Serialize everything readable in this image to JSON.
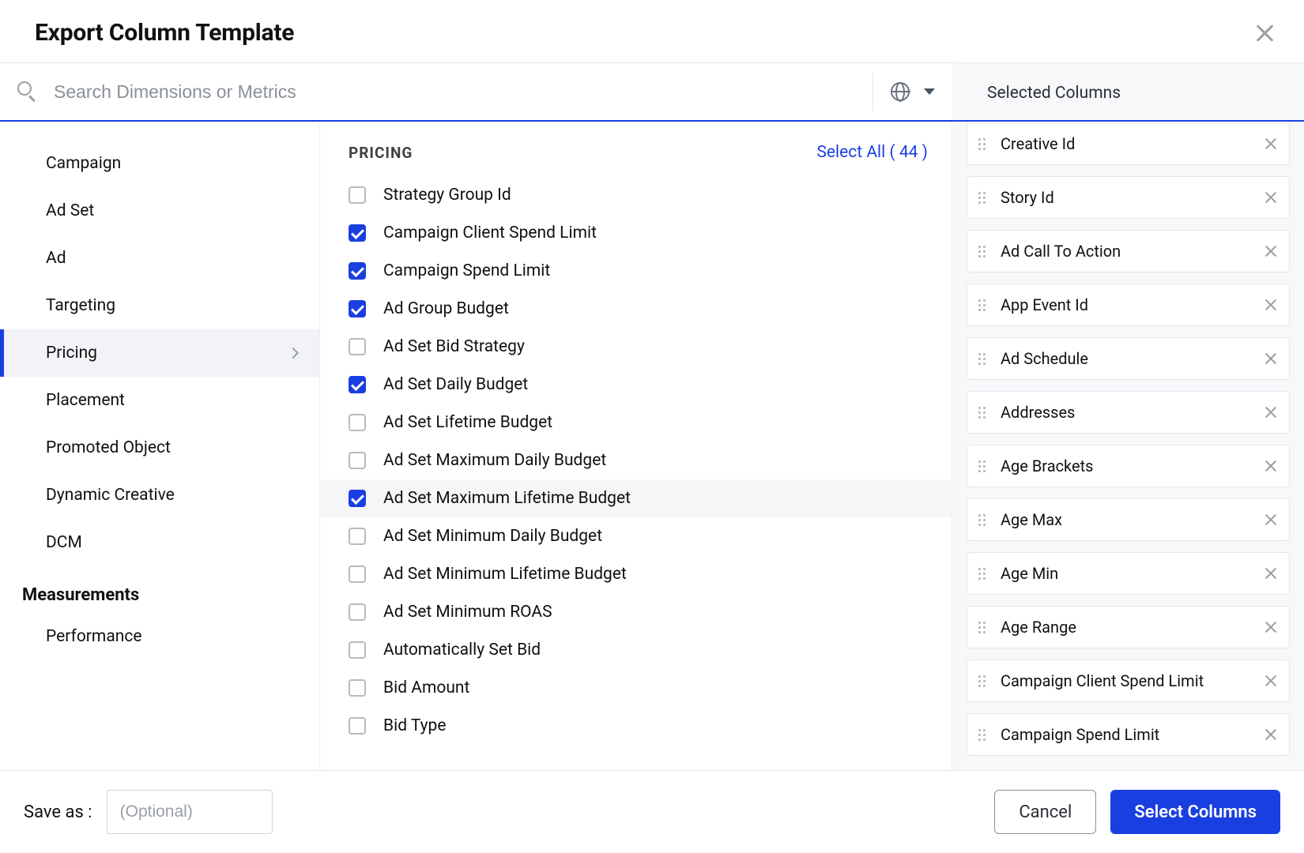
{
  "header": {
    "title": "Export Column Template"
  },
  "search": {
    "placeholder": "Search Dimensions or Metrics"
  },
  "nav": {
    "items": [
      {
        "label": "Campaign"
      },
      {
        "label": "Ad Set"
      },
      {
        "label": "Ad"
      },
      {
        "label": "Targeting"
      },
      {
        "label": "Pricing",
        "active": true
      },
      {
        "label": "Placement"
      },
      {
        "label": "Promoted Object"
      },
      {
        "label": "Dynamic Creative"
      },
      {
        "label": "DCM"
      }
    ],
    "section": "Measurements",
    "section_items": [
      {
        "label": "Performance"
      }
    ]
  },
  "middle": {
    "title": "PRICING",
    "select_all_label": "Select All ( 44 )",
    "options": [
      {
        "label": "Strategy Group Id",
        "checked": false
      },
      {
        "label": "Campaign Client Spend Limit",
        "checked": true
      },
      {
        "label": "Campaign Spend Limit",
        "checked": true
      },
      {
        "label": "Ad Group Budget",
        "checked": true
      },
      {
        "label": "Ad Set Bid Strategy",
        "checked": false
      },
      {
        "label": "Ad Set Daily Budget",
        "checked": true
      },
      {
        "label": "Ad Set Lifetime Budget",
        "checked": false
      },
      {
        "label": "Ad Set Maximum Daily Budget",
        "checked": false
      },
      {
        "label": "Ad Set Maximum Lifetime Budget",
        "checked": true,
        "hover": true
      },
      {
        "label": "Ad Set Minimum Daily Budget",
        "checked": false
      },
      {
        "label": "Ad Set Minimum Lifetime Budget",
        "checked": false
      },
      {
        "label": "Ad Set Minimum ROAS",
        "checked": false
      },
      {
        "label": "Automatically Set Bid",
        "checked": false
      },
      {
        "label": "Bid Amount",
        "checked": false
      },
      {
        "label": "Bid Type",
        "checked": false
      }
    ]
  },
  "selected": {
    "title": "Selected Columns",
    "items": [
      "Creative Id",
      "Story Id",
      "Ad Call To Action",
      "App Event Id",
      "Ad Schedule",
      "Addresses",
      "Age Brackets",
      "Age Max",
      "Age Min",
      "Age Range",
      "Campaign Client Spend Limit",
      "Campaign Spend Limit"
    ]
  },
  "footer": {
    "save_label": "Save as :",
    "save_placeholder": "(Optional)",
    "cancel": "Cancel",
    "confirm": "Select Columns"
  }
}
